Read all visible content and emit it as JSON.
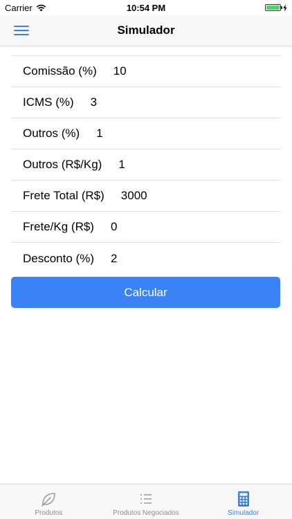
{
  "status_bar": {
    "carrier": "Carrier",
    "time": "10:54 PM",
    "battery_level": 1.0
  },
  "header": {
    "title": "Simulador",
    "menu_icon": "hamburger-menu-icon"
  },
  "form": {
    "fields": [
      {
        "label": "Comissão (%)",
        "value": "10"
      },
      {
        "label": "ICMS (%)",
        "value": "3"
      },
      {
        "label": "Outros (%)",
        "value": "1"
      },
      {
        "label": "Outros (R$/Kg)",
        "value": "1"
      },
      {
        "label": "Frete Total (R$)",
        "value": "3000"
      },
      {
        "label": "Frete/Kg (R$)",
        "value": "0"
      },
      {
        "label": "Desconto (%)",
        "value": "2"
      }
    ]
  },
  "calculate_button": {
    "label": "Calcular"
  },
  "tab_bar": {
    "tabs": [
      {
        "label": "Produtos",
        "icon": "leaf-icon",
        "active": false
      },
      {
        "label": "Produtos Negociados",
        "icon": "list-icon",
        "active": false
      },
      {
        "label": "Simulador",
        "icon": "calculator-icon",
        "active": true
      }
    ]
  },
  "colors": {
    "accent": "#3b7fe0",
    "button": "#3b82f6",
    "battery": "#4cd964",
    "inactive_tab": "#8e8e93"
  }
}
